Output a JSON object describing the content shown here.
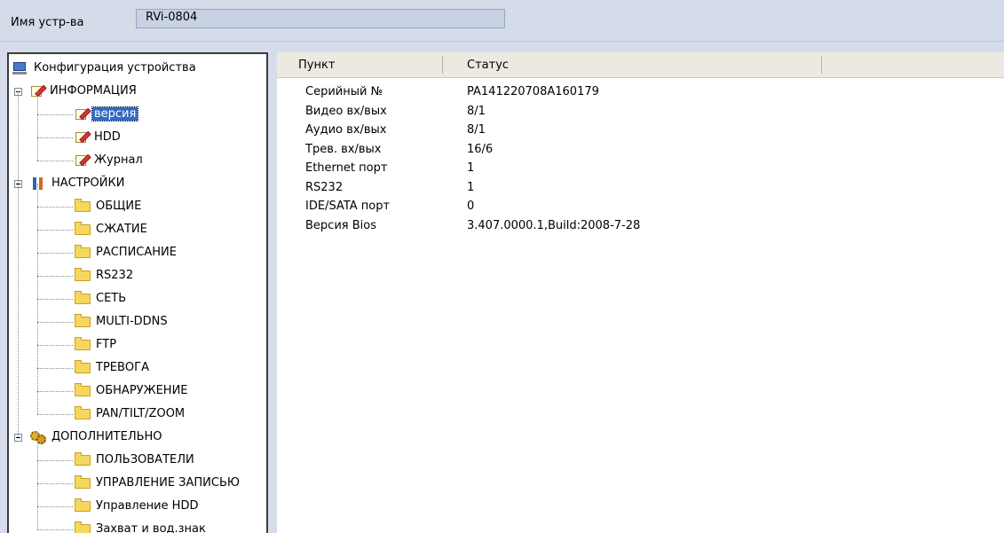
{
  "header": {
    "device_label": "Имя устр-ва",
    "device_name": "RVi-0804"
  },
  "tree": {
    "root": "Конфигурация устройства",
    "info": {
      "label": "ИНФОРМАЦИЯ",
      "items": [
        "версия",
        "HDD",
        "Журнал"
      ],
      "selected": "версия"
    },
    "settings": {
      "label": "НАСТРОЙКИ",
      "items": [
        "ОБЩИЕ",
        "СЖАТИЕ",
        "РАСПИСАНИЕ",
        "RS232",
        "СЕТЬ",
        "MULTI-DDNS",
        "FTP",
        "ТРЕВОГА",
        "ОБНАРУЖЕНИЕ",
        "PAN/TILT/ZOOM"
      ]
    },
    "extra": {
      "label": "ДОПОЛНИТЕЛЬНО",
      "items": [
        "ПОЛЬЗОВАТЕЛИ",
        "УПРАВЛЕНИЕ ЗАПИСЬЮ",
        "Управление HDD",
        "Захват и вод.знак"
      ]
    }
  },
  "table": {
    "columns": [
      "Пункт",
      "Статус"
    ],
    "rows": [
      [
        "Серийный №",
        "PA141220708A160179"
      ],
      [
        "Видео вх/вых",
        "8/1"
      ],
      [
        "Аудио вх/вых",
        "8/1"
      ],
      [
        "Трев. вх/вых",
        "16/6"
      ],
      [
        "Ethernet порт",
        "1"
      ],
      [
        "RS232",
        "1"
      ],
      [
        "IDE/SATA порт",
        "0"
      ],
      [
        "Версия Bios",
        "3.407.0000.1,Build:2008-7-28"
      ]
    ]
  },
  "icons": {
    "root": "computer-icon",
    "info": "note-pencil-icon",
    "settings": "tools-icon",
    "extra": "gears-icon",
    "leaf": "folder-icon"
  },
  "colors": {
    "selection": "#316ac5",
    "window_bg": "#d6dcea",
    "folder": "#f7d65e"
  }
}
